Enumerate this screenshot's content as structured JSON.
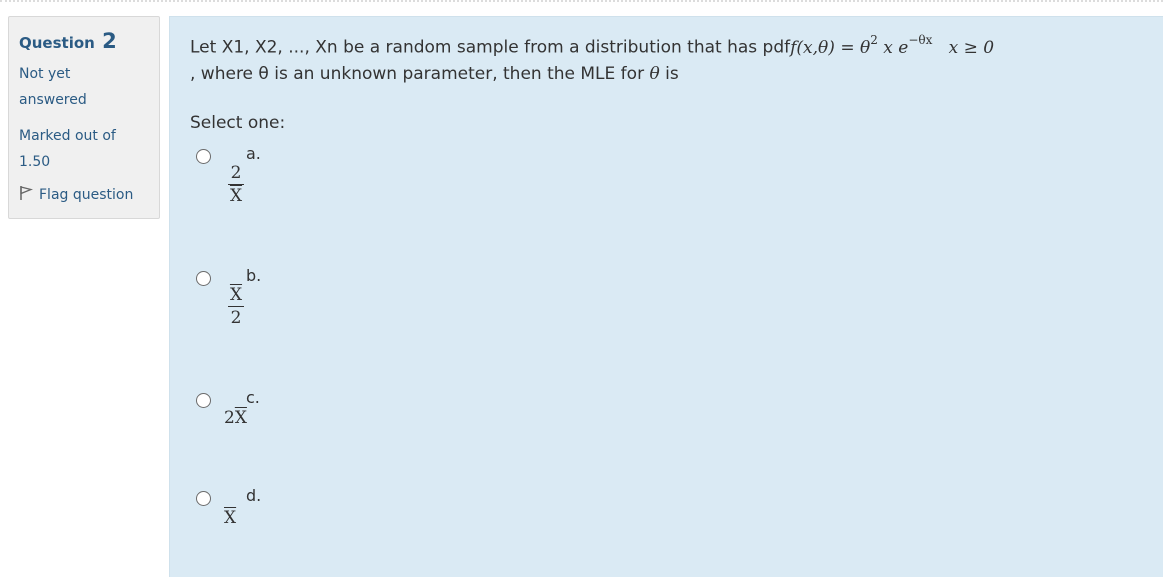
{
  "info": {
    "question_label": "Question",
    "question_number": "2",
    "state": "Not yet answered",
    "grade": "Marked out of 1.50",
    "flag_label": "Flag question"
  },
  "question": {
    "text_line1": "Let X1, X2, ..., Xn be a random sample from a distribution that has pdf",
    "formula": "f(x,θ) = θ² x e^(−θx)   x ≥ 0",
    "formula_f": "f(x,θ)",
    "formula_eq": "=",
    "formula_theta": "θ",
    "formula_sq": "2",
    "formula_x": "x e",
    "formula_exp": "−θx",
    "formula_cond": "x ≥ 0",
    "text_line2": ", where θ is an unknown parameter, then the MLE for",
    "theta_italic": "θ",
    "text_tail": "is",
    "prompt": "Select one:"
  },
  "options": [
    {
      "letter": "a.",
      "num": "2",
      "den": "X",
      "expr": "2 / X̄"
    },
    {
      "letter": "b.",
      "num": "X",
      "den": "2",
      "expr": "X̄ / 2"
    },
    {
      "letter": "c.",
      "coef": "2",
      "var": "X",
      "expr": "2X̄"
    },
    {
      "letter": "d.",
      "var": "X",
      "expr": "X̄"
    }
  ]
}
